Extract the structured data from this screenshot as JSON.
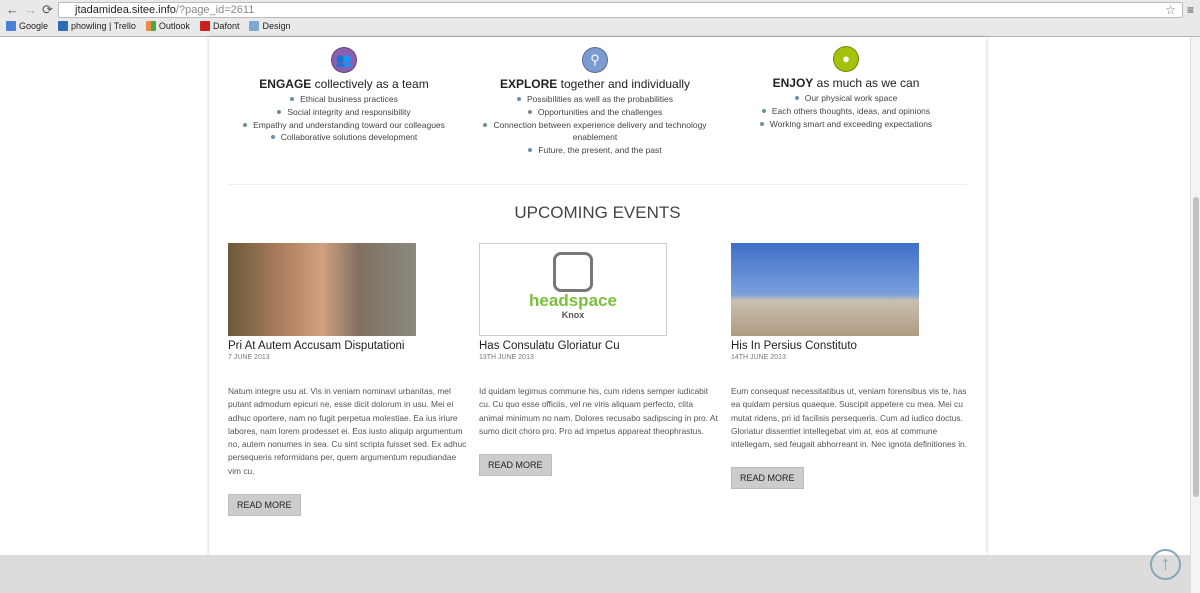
{
  "browser": {
    "url_host": "jtadamidea.sitee.info",
    "url_path": "/?page_id=2611",
    "bookmarks": [
      {
        "label": "Google",
        "color": "#4a7fd8"
      },
      {
        "label": "phowling | Trello",
        "color": "#2a6db0"
      },
      {
        "label": "Outlook",
        "color": "#e8a020"
      },
      {
        "label": "Dafont",
        "color": "#c8201e"
      },
      {
        "label": "Design",
        "color": "#7fa8d0"
      }
    ]
  },
  "values": [
    {
      "bold": "ENGAGE",
      "rest": " collectively as a team",
      "color": "#8a5fb0",
      "icon": "people-icon",
      "items": [
        "Ethical business practices",
        "Social integrity and responsibility",
        "Empathy and understanding toward our colleagues",
        "Collaborative solutions development"
      ]
    },
    {
      "bold": "EXPLORE",
      "rest": " together and individually",
      "color": "#7b9bd1",
      "icon": "search-icon",
      "items": [
        "Possibilities as well as the probabilities",
        "Opportunities and the challenges",
        "Connection between experience delivery and technology enablement",
        "Future, the present, and the past"
      ]
    },
    {
      "bold": "ENJOY",
      "rest": " as much as we can",
      "color": "#a4c20a",
      "icon": "map-pin-icon",
      "items": [
        "Our physical work space",
        "Each others thoughts, ideas, and opinions",
        "Working smart and exceeding expectations"
      ]
    }
  ],
  "events_title": "UPCOMING EVENTS",
  "events": [
    {
      "title": "Pri At Autem Accusam Disputationi",
      "date": "7 JUNE 2013",
      "body": "Natum integre usu at. Vis in veniam nominavi urbanitas, mel putant admodum epicuri ne, esse dicit dolorum in usu. Mei ei adhuc oportere, nam no fugit perpetua molestiae. Ea ius iriure labores, nam lorem prodesset ei. Eos iusto aliquip argumentum no, autem nonumes in sea. Cu sint scripta fuisset sed. Ex adhuc persequeris reformidans per, quem argumentum repudiandae vim cu.",
      "button": "READ MORE"
    },
    {
      "title": "Has Consulatu Gloriatur Cu",
      "date": "13TH JUNE 2013",
      "body": "Id quidam legimus commune his, cum ridens semper iudicabit cu. Cu quo esse officiis, vel ne viris aliquam perfecto, clita animal minimum no nam. Dolores recusabo sadipscing in pro. At sumo dicit choro pro. Pro ad impetus appareat theophrastus.",
      "button": "READ MORE",
      "logo_text": "headspace",
      "logo_sub": "Knox"
    },
    {
      "title": "His In Persius Constituto",
      "date": "14TH JUNE 2013",
      "body": "Eum consequat necessitatibus ut, veniam forensibus vis te, has ea quidam persius quaeque. Suscipit appetere cu mea. Mei cu mutat ridens, pri id facilisis persequeris. Cum ad iudico doctus. Gloriatur dissentiet intellegebat vim at, eos at commune intellegam, sed feugait abhorreant in. Nec ignota definitiones in.",
      "button": "READ MORE"
    }
  ]
}
